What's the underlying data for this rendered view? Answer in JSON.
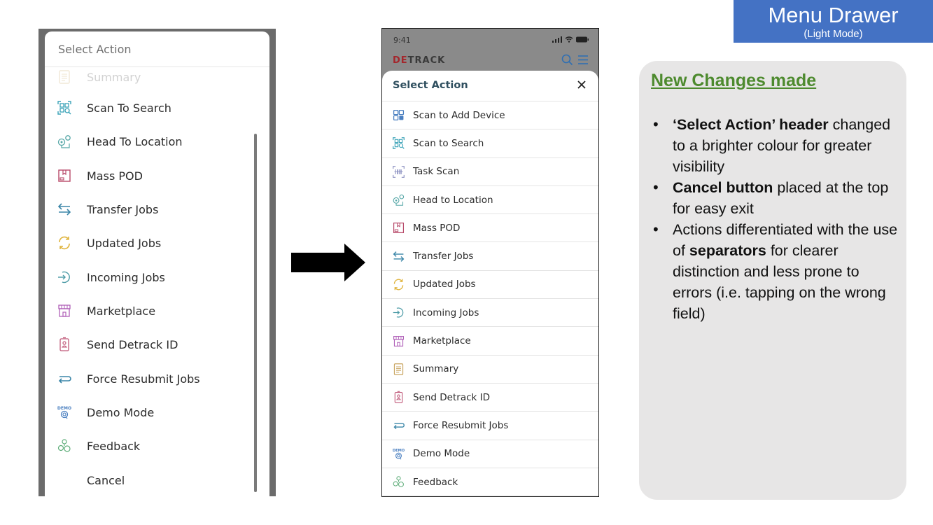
{
  "old_drawer": {
    "header": "Select Action",
    "items": [
      {
        "label": "Summary",
        "icon": "summary-icon",
        "faded": true
      },
      {
        "label": "Scan To Search",
        "icon": "scan-search-icon"
      },
      {
        "label": "Head To Location",
        "icon": "location-icon"
      },
      {
        "label": "Mass POD",
        "icon": "mass-pod-icon"
      },
      {
        "label": "Transfer Jobs",
        "icon": "transfer-icon"
      },
      {
        "label": "Updated Jobs",
        "icon": "refresh-icon"
      },
      {
        "label": "Incoming Jobs",
        "icon": "incoming-icon"
      },
      {
        "label": "Marketplace",
        "icon": "store-icon"
      },
      {
        "label": "Send Detrack ID",
        "icon": "id-badge-icon"
      },
      {
        "label": "Force Resubmit Jobs",
        "icon": "resubmit-icon"
      },
      {
        "label": "Demo Mode",
        "icon": "demo-icon"
      },
      {
        "label": "Feedback",
        "icon": "feedback-icon"
      },
      {
        "label": "Cancel",
        "icon": null
      }
    ]
  },
  "new_drawer": {
    "status_time": "9:41",
    "brand": {
      "part1": "DE",
      "part2": "TRACK"
    },
    "header": "Select Action",
    "close_label": "×",
    "items": [
      {
        "label": "Scan to Add Device",
        "icon": "scan-add-icon"
      },
      {
        "label": "Scan to Search",
        "icon": "scan-search-icon"
      },
      {
        "label": "Task Scan",
        "icon": "barcode-scan-icon"
      },
      {
        "label": "Head to Location",
        "icon": "location-icon"
      },
      {
        "label": "Mass POD",
        "icon": "mass-pod-icon"
      },
      {
        "label": "Transfer Jobs",
        "icon": "transfer-icon"
      },
      {
        "label": "Updated Jobs",
        "icon": "refresh-icon"
      },
      {
        "label": "Incoming Jobs",
        "icon": "incoming-icon"
      },
      {
        "label": "Marketplace",
        "icon": "store-icon"
      },
      {
        "label": "Summary",
        "icon": "summary-icon"
      },
      {
        "label": "Send Detrack ID",
        "icon": "id-badge-icon"
      },
      {
        "label": "Force Resubmit Jobs",
        "icon": "resubmit-icon"
      },
      {
        "label": "Demo Mode",
        "icon": "demo-icon"
      },
      {
        "label": "Feedback",
        "icon": "feedback-icon"
      }
    ]
  },
  "title_badge": {
    "main": "Menu Drawer",
    "sub": "(Light Mode)"
  },
  "notes": {
    "title": "New Changes made",
    "bullets": [
      {
        "bold": "‘Select Action’ header",
        "rest": " changed to a brighter colour for greater visibility"
      },
      {
        "bold": "Cancel button",
        "rest": " placed at the top for easy exit"
      },
      {
        "pre": "Actions differentiated with the use of ",
        "bold": "separators",
        "rest": " for clearer distinction and less prone to errors (i.e. tapping on the wrong field)"
      }
    ]
  },
  "colors": {
    "badge_bg": "#4472c4",
    "notes_title": "#4d8a2e",
    "notes_bg": "#e7e6e6",
    "new_header_text": "#2f4f5f",
    "brand_red": "#a4262c",
    "app_icon_blue": "#2f6fb3"
  }
}
